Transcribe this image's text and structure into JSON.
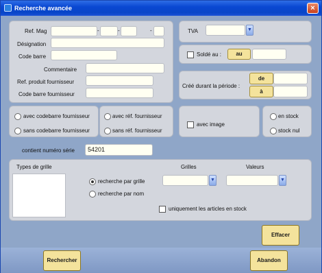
{
  "window": {
    "title": "Recherche avancée",
    "close_glyph": "×"
  },
  "ref_mag": {
    "label": "Ref. Mag",
    "dash": "-"
  },
  "designation": {
    "label": "Désignation"
  },
  "code_barre": {
    "label": "Code barre"
  },
  "commentaire": {
    "label": "Commentaire"
  },
  "ref_produit_fournisseur": {
    "label": "Ref. produit fournisseur"
  },
  "code_barre_fournisseur": {
    "label": "Code barre fournisseur"
  },
  "tva": {
    "label": "TVA",
    "value": ""
  },
  "solde": {
    "label": "Soldé au :",
    "au_button": "au"
  },
  "periode": {
    "label": "Créé durant la période :",
    "de_button": "de",
    "a_button": "à"
  },
  "codebarre_fournisseur": {
    "avec": "avec codebarre fournisseur",
    "sans": "sans codebarre fournisseur"
  },
  "ref_fournisseur": {
    "avec": "avec réf. fournisseur",
    "sans": "sans réf. fournisseur"
  },
  "avec_image": {
    "label": "avec image"
  },
  "stock": {
    "en_stock": "en stock",
    "stock_nul": "stock nul"
  },
  "numero_serie": {
    "label": "contient numéro série",
    "value": "54201"
  },
  "grille": {
    "types_label": "Types de grille",
    "grilles_label": "Grilles",
    "valeurs_label": "Valeurs",
    "par_grille": "recherche par grille",
    "par_nom": "recherche par nom",
    "en_stock_only": "uniquement les articles en stock"
  },
  "buttons": {
    "effacer": "Effacer",
    "rechercher": "Rechercher",
    "abandon": "Abandon"
  },
  "icons": {
    "dropdown": "chevron-down-icon"
  }
}
